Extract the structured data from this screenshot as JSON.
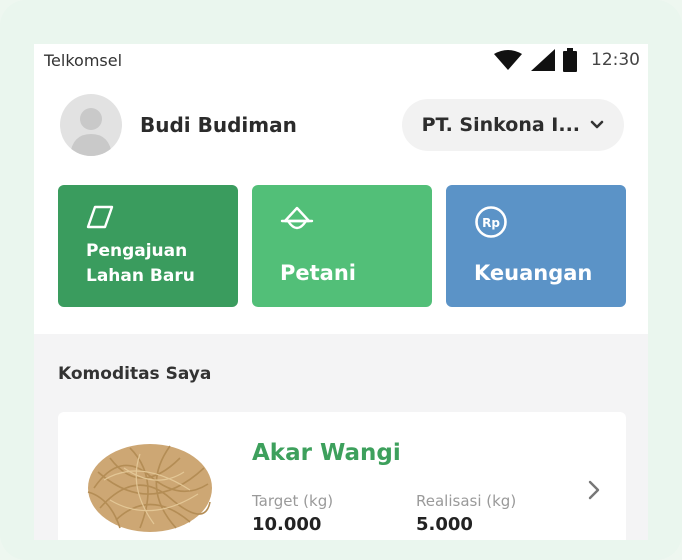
{
  "status_bar": {
    "carrier": "Telkomsel",
    "time": "12:30"
  },
  "user": {
    "name": "Budi Budiman"
  },
  "company_selector": {
    "label": "PT. Sinkona I..."
  },
  "menu_cards": [
    {
      "label_line1": "Pengajuan",
      "label_line2": "Lahan Baru",
      "color": "#3a9c5e"
    },
    {
      "label": "Petani",
      "color": "#52bf78"
    },
    {
      "label": "Keuangan",
      "color": "#5b93c7"
    }
  ],
  "section": {
    "title": "Komoditas Saya"
  },
  "commodity": {
    "name": "Akar Wangi",
    "target_label": "Target (kg)",
    "target_value": "10.000",
    "realisasi_label": "Realisasi (kg)",
    "realisasi_value": "5.000"
  }
}
